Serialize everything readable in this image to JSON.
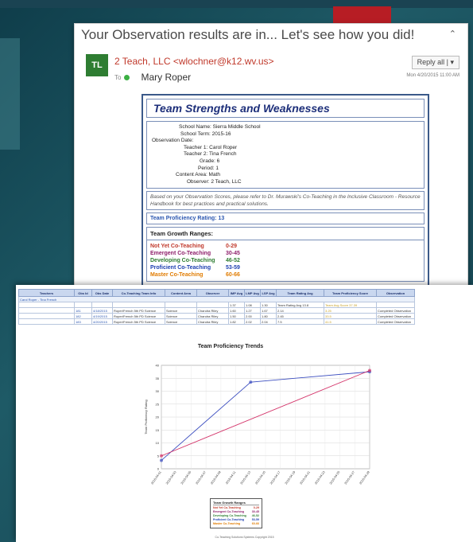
{
  "email": {
    "subject": "Your Observation results are in... Let's see how you did!",
    "avatar_initials": "TL",
    "sender": "2 Teach, LLC <wlochner@k12.wv.us>",
    "to_label": "To",
    "recipient": "Mary Roper",
    "reply_label": "Reply all | ▾",
    "date": "Mon 4/20/2015 11:00 AM",
    "collapse_icon": "chevron-up-icon"
  },
  "report": {
    "title": "Team Strengths and Weaknesses",
    "info": [
      {
        "label": "School Name:",
        "value": "Sierra Middle School"
      },
      {
        "label": "School Term:",
        "value": "2015-16"
      },
      {
        "label": "Observation Date:",
        "value": ""
      },
      {
        "label": "Teacher 1:",
        "value": "Carol Roper"
      },
      {
        "label": "Teacher 2:",
        "value": "Tina French"
      },
      {
        "label": "Grade:",
        "value": "6"
      },
      {
        "label": "Period:",
        "value": "1"
      },
      {
        "label": "Content Area:",
        "value": "Math"
      },
      {
        "label": "Observer:",
        "value": "2 Teach, LLC"
      }
    ],
    "note": "Based on your Observation Scores, please refer to Dr. Murawski's Co-Teaching in the Inclusive Classroom - Resource Handbook for best practices and practical solutions.",
    "rating_label": "Team Proficiency Rating: 13",
    "growth_title": "Team Growth Ranges:",
    "ranges": [
      {
        "label": "Not Yet Co-Teaching",
        "value": "0-29",
        "color": "#c0392b"
      },
      {
        "label": "Emergent Co-Teaching",
        "value": "30-45",
        "color": "#8e1f6b"
      },
      {
        "label": "Developing Co-Teaching",
        "value": "46-52",
        "color": "#2e7d32"
      },
      {
        "label": "Proficient Co-Teaching",
        "value": "53-59",
        "color": "#1d3fb0"
      },
      {
        "label": "Master Co-Teaching",
        "value": "60-66",
        "color": "#e07b00"
      }
    ]
  },
  "table": {
    "headers": [
      "Teachers",
      "Obs Id",
      "Obs Date",
      "Co-Teaching Team Info",
      "Content Area",
      "Observer",
      "IMP Avg",
      "LMP Avg",
      "LSP Avg",
      "Team Rating Avg",
      "Team Proficiency Score",
      "Observation"
    ],
    "group_label": "Carol Roper - Tina French",
    "summary_row": [
      "",
      "",
      "",
      "",
      "",
      "",
      "1.37",
      "1.08",
      "1.30",
      "Team Rating Avg 13.8",
      "Team Avg Score 37.39",
      ""
    ],
    "rows": [
      [
        "",
        "181",
        "4/18/2015",
        "Roper/French 5th PD Science",
        "Science",
        "Chandra Riley",
        "1.60",
        "1.27",
        "1.67",
        "2.14",
        "3.25",
        "Completed Observation"
      ],
      [
        "",
        "182",
        "4/19/2015",
        "Roper/French 5th PD Science",
        "Science",
        "Chandra Riley",
        "1.50",
        "2.00",
        "1.80",
        "2.45",
        "33.5",
        "Completed Observation"
      ],
      [
        "",
        "183",
        "4/20/2015",
        "Roper/French 5th PD Science",
        "Science",
        "Chandra Riley",
        "1.82",
        "2.02",
        "2.04",
        "7.5",
        "41.5",
        "Completed Observation"
      ]
    ]
  },
  "chart_data": {
    "type": "line",
    "title": "Team Proficiency Trends",
    "ylabel": "Team Proficiency Rating",
    "xlabel": "",
    "ylim": [
      0,
      40
    ],
    "yticks": [
      0,
      5,
      10,
      15,
      20,
      25,
      30,
      35,
      40
    ],
    "x": [
      "2015-04-01",
      "2015-04-03",
      "2015-04-05",
      "2015-04-07",
      "2015-04-09",
      "2015-04-11",
      "2015-04-13",
      "2015-04-15",
      "2015-04-17",
      "2015-04-19",
      "2015-04-21",
      "2015-04-23",
      "2015-04-25",
      "2015-04-27",
      "2015-04-29"
    ],
    "series": [
      {
        "values": [
          [
            0,
            3.25
          ],
          [
            6,
            33.5
          ],
          [
            14,
            37.5
          ]
        ],
        "color": "#3d4fc0"
      },
      {
        "values": [
          [
            0,
            5
          ],
          [
            14,
            38
          ]
        ],
        "color": "#d4346a"
      }
    ],
    "grid": true
  },
  "legend": {
    "title": "Team Growth Ranges",
    "rows": [
      {
        "label": "Not Yet Co-Teaching",
        "value": "0-29",
        "color": "#c0392b"
      },
      {
        "label": "Emergent Co-Teaching",
        "value": "30-45",
        "color": "#8e1f6b"
      },
      {
        "label": "Developing Co-Teaching",
        "value": "46-52",
        "color": "#2e7d32"
      },
      {
        "label": "Proficient Co-Teaching",
        "value": "53-59",
        "color": "#1d3fb0"
      },
      {
        "label": "Master Co-Teaching",
        "value": "60-66",
        "color": "#e07b00"
      }
    ]
  },
  "copyright": "Co-Teaching Solutions Systems Copyright 2015"
}
